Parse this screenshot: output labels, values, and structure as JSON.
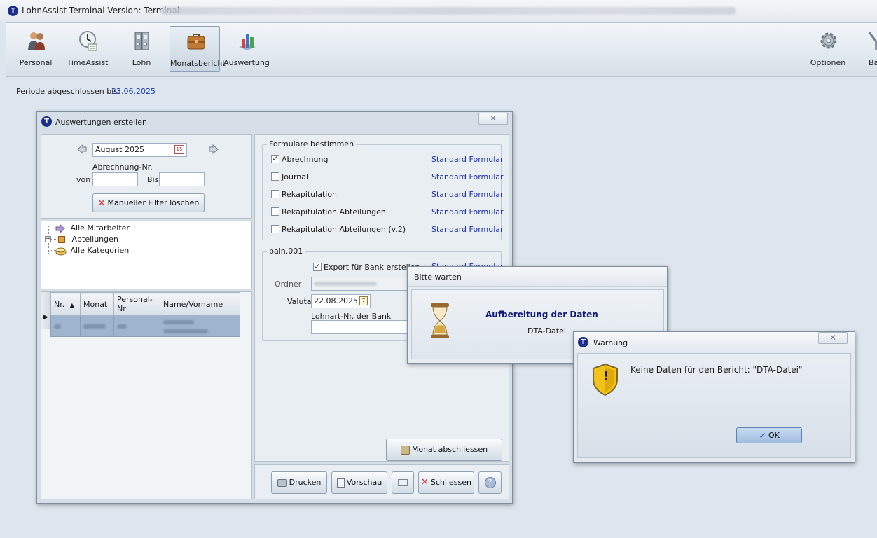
{
  "app": {
    "title": "LohnAssist Terminal Version: Terminal:"
  },
  "ribbon": {
    "items": [
      {
        "label": "Personal",
        "icon": "people-icon"
      },
      {
        "label": "TimeAssist",
        "icon": "clock-icon"
      },
      {
        "label": "Lohn",
        "icon": "binders-icon"
      },
      {
        "label": "Monatsbericht",
        "icon": "briefcase-icon",
        "active": true
      },
      {
        "label": "Auswertung",
        "icon": "chart-icon"
      }
    ],
    "right_items": [
      {
        "label": "Optionen",
        "icon": "gear-icon"
      },
      {
        "label": "Ba",
        "icon": "tools-icon"
      }
    ]
  },
  "period": {
    "label": "Periode abgeschlossen bis:",
    "value": "23.06.2025"
  },
  "report_dialog": {
    "title": "Auswertungen erstellen",
    "close": "✕",
    "month": "August 2025",
    "calendar_day": "15",
    "abrechnung_label": "Abrechnung-Nr.",
    "von_label": "von",
    "bis_label": "Bis",
    "filter_button": "Manueller Filter löschen",
    "tree": [
      "Alle Mitarbeiter",
      "Abteilungen",
      "Alle Kategorien"
    ],
    "tree_expander": "+",
    "grid": {
      "columns": [
        "Nr.",
        "Monat",
        "Personal-Nr",
        "Name/Vorname"
      ],
      "sort_indicator": "▲",
      "row_marker": "▶"
    },
    "formulare": {
      "legend": "Formulare bestimmen",
      "items": [
        {
          "label": "Abrechnung",
          "checked": true,
          "link": "Standard Formular"
        },
        {
          "label": "Journal",
          "checked": false,
          "link": "Standard Formular"
        },
        {
          "label": "Rekapitulation",
          "checked": false,
          "link": "Standard Formular"
        },
        {
          "label": "Rekapitulation Abteilungen",
          "checked": false,
          "link": "Standard Formular"
        },
        {
          "label": "Rekapitulation Abteilungen (v.2)",
          "checked": false,
          "link": "Standard Formular"
        }
      ]
    },
    "pain": {
      "legend": "pain.001",
      "export_label": "Export für Bank erstellen",
      "export_checked": true,
      "export_link": "Standard Formular",
      "ordner_label": "Ordner",
      "valuta_label": "Valuta",
      "valuta_value": "22.08.2025",
      "valuta_calendar_day": "7",
      "lohnart_label": "Lohnart-Nr. der Bank"
    },
    "close_month_button": "Monat abschliessen",
    "buttons": {
      "print": "Drucken",
      "preview": "Vorschau",
      "close": "Schliessen",
      "help": "?"
    }
  },
  "wait_dialog": {
    "title": "Bitte warten",
    "heading": "Aufbereitung der Daten",
    "subtext": "DTA-Datei"
  },
  "warning_dialog": {
    "title": "Warnung",
    "close": "✕",
    "message": "Keine Daten für den Bericht: \"DTA-Datei\"",
    "ok": "OK",
    "ok_check": "✓",
    "shield_mark": "!"
  },
  "colors": {
    "accent": "#1c2fb0",
    "heading": "#101a7a",
    "selection": "#9fb4cd"
  }
}
